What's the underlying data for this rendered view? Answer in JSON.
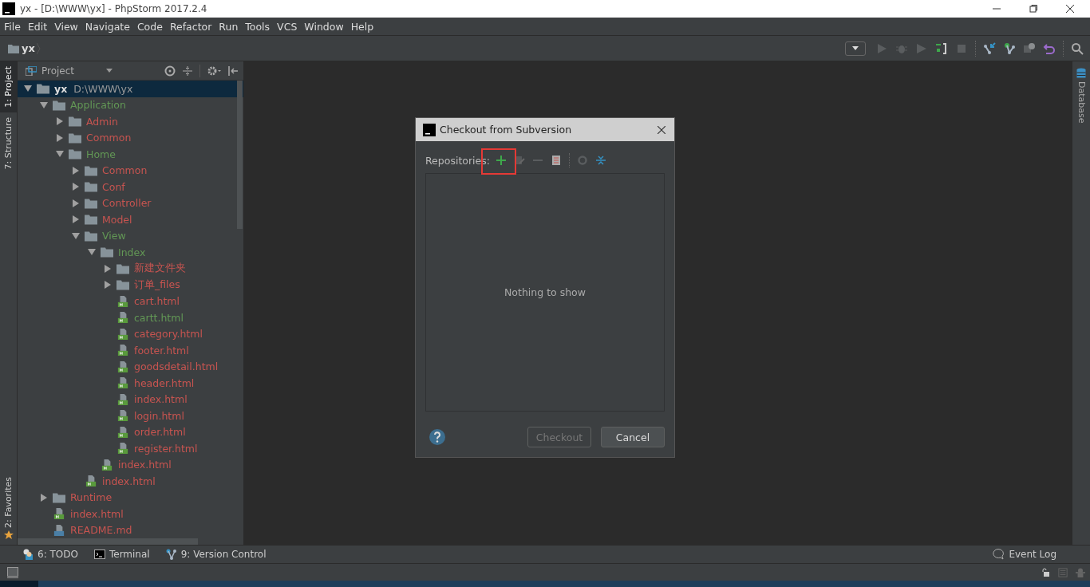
{
  "window": {
    "title": "yx - [D:\\WWW\\yx] - PhpStorm 2017.2.4"
  },
  "menu": [
    "File",
    "Edit",
    "View",
    "Navigate",
    "Code",
    "Refactor",
    "Run",
    "Tools",
    "VCS",
    "Window",
    "Help"
  ],
  "breadcrumb": "yx",
  "left_strip": [
    {
      "label": "1: Project",
      "selected": true
    },
    {
      "label": "7: Structure",
      "selected": false
    }
  ],
  "left_strip_bottom": [
    {
      "label": "2: Favorites",
      "selected": false
    }
  ],
  "right_strip": [
    {
      "label": "Database",
      "selected": false
    }
  ],
  "project_panel": {
    "title": "Project"
  },
  "tree": [
    {
      "name": "yx",
      "path": "D:\\WWW\\yx",
      "kind": "root",
      "expanded": true,
      "selected": true,
      "children": [
        {
          "name": "Application",
          "kind": "folder",
          "color": "#629755",
          "expanded": true,
          "selected": false,
          "children": [
            {
              "name": "Admin",
              "kind": "folder",
              "color": "#c75450",
              "expanded": false,
              "selected": false
            },
            {
              "name": "Common",
              "kind": "folder",
              "color": "#c75450",
              "expanded": false,
              "selected": false
            },
            {
              "name": "Home",
              "kind": "folder",
              "color": "#629755",
              "expanded": true,
              "selected": false,
              "children": [
                {
                  "name": "Common",
                  "kind": "folder",
                  "color": "#c75450",
                  "expanded": false,
                  "selected": false
                },
                {
                  "name": "Conf",
                  "kind": "folder",
                  "color": "#c75450",
                  "expanded": false,
                  "selected": false
                },
                {
                  "name": "Controller",
                  "kind": "folder",
                  "color": "#c75450",
                  "expanded": false,
                  "selected": false
                },
                {
                  "name": "Model",
                  "kind": "folder",
                  "color": "#c75450",
                  "expanded": false,
                  "selected": false
                },
                {
                  "name": "View",
                  "kind": "folder",
                  "color": "#629755",
                  "expanded": true,
                  "selected": false,
                  "children": [
                    {
                      "name": "Index",
                      "kind": "folder",
                      "color": "#629755",
                      "expanded": true,
                      "selected": false,
                      "children": [
                        {
                          "name": "新建文件夹",
                          "kind": "folder",
                          "color": "#c75450",
                          "expanded": false,
                          "selected": false
                        },
                        {
                          "name": "订单_files",
                          "kind": "folder",
                          "color": "#c75450",
                          "expanded": false,
                          "selected": false
                        },
                        {
                          "name": "cart.html",
                          "kind": "html",
                          "color": "#c75450",
                          "selected": false
                        },
                        {
                          "name": "cartt.html",
                          "kind": "html",
                          "color": "#629755",
                          "selected": false
                        },
                        {
                          "name": "category.html",
                          "kind": "html",
                          "color": "#c75450",
                          "selected": false
                        },
                        {
                          "name": "footer.html",
                          "kind": "html",
                          "color": "#c75450",
                          "selected": false
                        },
                        {
                          "name": "goodsdetail.html",
                          "kind": "html",
                          "color": "#c75450",
                          "selected": false
                        },
                        {
                          "name": "header.html",
                          "kind": "html",
                          "color": "#c75450",
                          "selected": false
                        },
                        {
                          "name": "index.html",
                          "kind": "html",
                          "color": "#c75450",
                          "selected": false
                        },
                        {
                          "name": "login.html",
                          "kind": "html",
                          "color": "#c75450",
                          "selected": false
                        },
                        {
                          "name": "order.html",
                          "kind": "html",
                          "color": "#c75450",
                          "selected": false
                        },
                        {
                          "name": "register.html",
                          "kind": "html",
                          "color": "#c75450",
                          "selected": false
                        }
                      ]
                    },
                    {
                      "name": "index.html",
                      "kind": "html",
                      "color": "#c75450",
                      "selected": false
                    }
                  ]
                },
                {
                  "name": "index.html",
                  "kind": "html",
                  "color": "#c75450",
                  "selected": false
                }
              ]
            }
          ]
        },
        {
          "name": "Runtime",
          "kind": "folder",
          "color": "#c75450",
          "expanded": false,
          "selected": false
        },
        {
          "name": "index.html",
          "kind": "html",
          "color": "#c75450",
          "selected": false
        },
        {
          "name": "README.md",
          "kind": "md",
          "color": "#c75450",
          "selected": false
        }
      ]
    }
  ],
  "dialog": {
    "title": "Checkout from Subversion",
    "repositories_label": "Repositories:",
    "empty_text": "Nothing to show",
    "buttons": [
      {
        "label": "Checkout",
        "disabled": true
      },
      {
        "label": "Cancel",
        "disabled": false
      }
    ]
  },
  "bottom_tools": [
    {
      "label": "6: TODO",
      "kind": "todo"
    },
    {
      "label": "Terminal",
      "kind": "terminal"
    },
    {
      "label": "9: Version Control",
      "kind": "vcs"
    }
  ],
  "event_log": "Event Log"
}
